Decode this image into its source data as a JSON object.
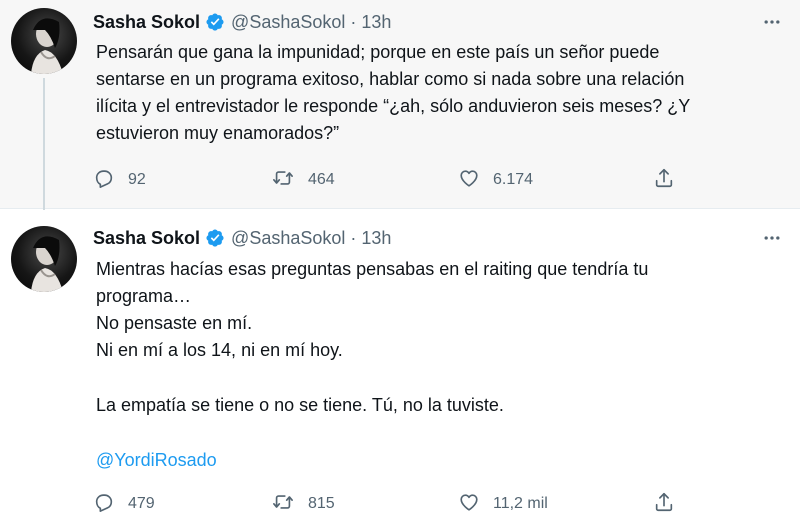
{
  "colors": {
    "accent": "#1d9bf0",
    "secondary_text": "#536471",
    "primary_text": "#0f1419",
    "background_highlight": "#f7f7f7"
  },
  "icons": [
    "avatar-image",
    "verified-badge-icon",
    "more-icon",
    "reply-icon",
    "retweet-icon",
    "like-icon",
    "share-icon"
  ],
  "tweets": [
    {
      "author_name": "Sasha Sokol",
      "handle": "@SashaSokol",
      "separator": "·",
      "time": "13h",
      "lines": [
        "Pensarán que gana la impunidad; porque en este país un señor puede",
        "sentarse en un programa exitoso, hablar como si nada sobre una relación",
        "ilícita y el entrevistador le responde “¿ah, sólo anduvieron seis meses? ¿Y",
        "estuvieron muy enamorados?”"
      ],
      "replies": "92",
      "retweets": "464",
      "likes": "6.174"
    },
    {
      "author_name": "Sasha Sokol",
      "handle": "@SashaSokol",
      "separator": "·",
      "time": "13h",
      "lines": [
        "Mientras hacías esas preguntas pensabas en el raiting que tendría tu",
        "programa…",
        "No pensaste en mí.",
        "Ni en mí a los 14, ni en mí hoy.",
        "La empatía se tiene o no se tiene. Tú, no la tuviste."
      ],
      "mention": "@YordiRosado",
      "replies": "479",
      "retweets": "815",
      "likes": "11,2 mil"
    }
  ]
}
